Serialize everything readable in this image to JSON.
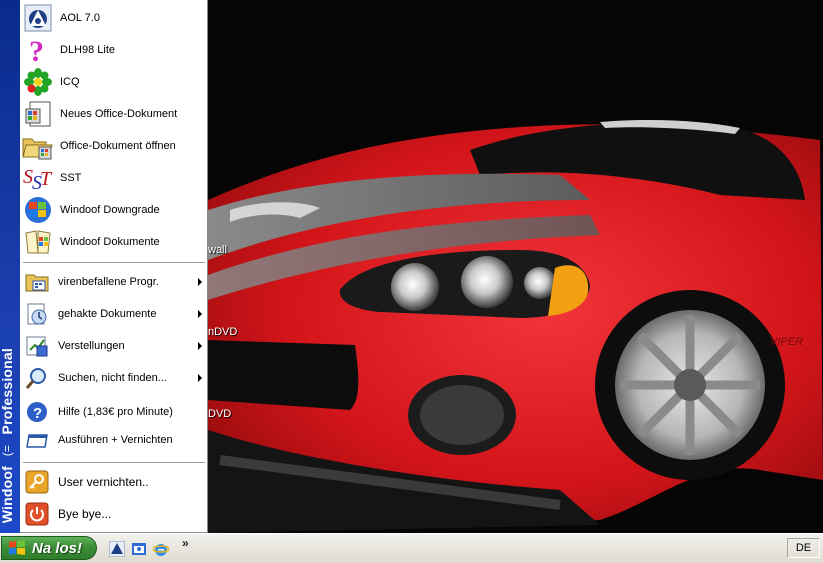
{
  "desktop": {
    "labels": [
      "wall",
      "nDVD",
      "DVD"
    ]
  },
  "start_menu": {
    "side_band": {
      "brand": "Windoof",
      "arrow": "(=",
      "edition": "Professional"
    },
    "pinned_items": [
      {
        "label": "AOL 7.0",
        "icon": "aol-icon"
      },
      {
        "label": "DLH98 Lite",
        "icon": "question-icon"
      },
      {
        "label": "ICQ",
        "icon": "icq-flower-icon"
      },
      {
        "label": "Neues Office-Dokument",
        "icon": "new-office-doc-icon"
      },
      {
        "label": "Office-Dokument öffnen",
        "icon": "open-office-doc-icon"
      },
      {
        "label": "SST",
        "icon": "sst-icon"
      },
      {
        "label": "Windoof Downgrade",
        "icon": "windows-update-icon"
      },
      {
        "label": "Windoof Dokumente",
        "icon": "windows-documents-icon"
      }
    ],
    "program_items": [
      {
        "label": "virenbefallene Progr.",
        "icon": "programs-icon",
        "submenu": true
      },
      {
        "label": "gehakte Dokumente",
        "icon": "documents-icon",
        "submenu": true
      },
      {
        "label": "Verstellungen",
        "icon": "settings-icon",
        "submenu": true
      },
      {
        "label": "Suchen, nicht finden...",
        "icon": "search-icon",
        "submenu": true
      },
      {
        "label": "Hilfe (1,83€ pro Minute)",
        "icon": "help-icon",
        "submenu": false
      },
      {
        "label": "Ausführen + Vernichten",
        "icon": "run-icon",
        "submenu": false
      }
    ],
    "session_items": [
      {
        "label": "User vernichten..",
        "icon": "key-icon"
      },
      {
        "label": "Bye bye...",
        "icon": "power-icon"
      }
    ]
  },
  "taskbar": {
    "start_label": "Na los!",
    "quick_launch": [
      "aol-launch-icon",
      "outlook-launch-icon",
      "ie-launch-icon"
    ],
    "overflow": "»",
    "language": "DE"
  },
  "colors": {
    "side_band": "#1b3fb0",
    "start_button": "#3c8f37",
    "taskbar": "#e5e2d8",
    "car_red": "#d8151a"
  }
}
